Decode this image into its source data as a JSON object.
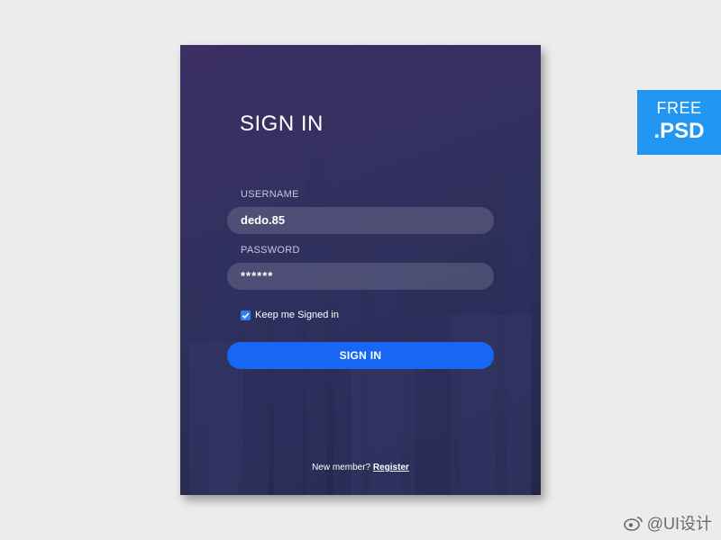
{
  "signin_form": {
    "title": "SIGN IN",
    "username_label": "USERNAME",
    "username_value": "dedo.85",
    "password_label": "PASSWORD",
    "password_value": "******",
    "keep_signed_in_label": "Keep me Signed in",
    "keep_signed_in_checked": true,
    "submit_label": "SIGN IN",
    "footer_text": "New member?",
    "register_link": "Register"
  },
  "badge": {
    "line1": "FREE",
    "line2": ".PSD"
  },
  "watermark": {
    "text": "@UI设计"
  },
  "colors": {
    "page_background": "#ececec",
    "card_gradient_top": "#3c2f62",
    "card_gradient_bottom": "#222748",
    "primary_button": "#1866f4",
    "checkbox": "#2f7df4",
    "badge_background": "#2196f3"
  }
}
